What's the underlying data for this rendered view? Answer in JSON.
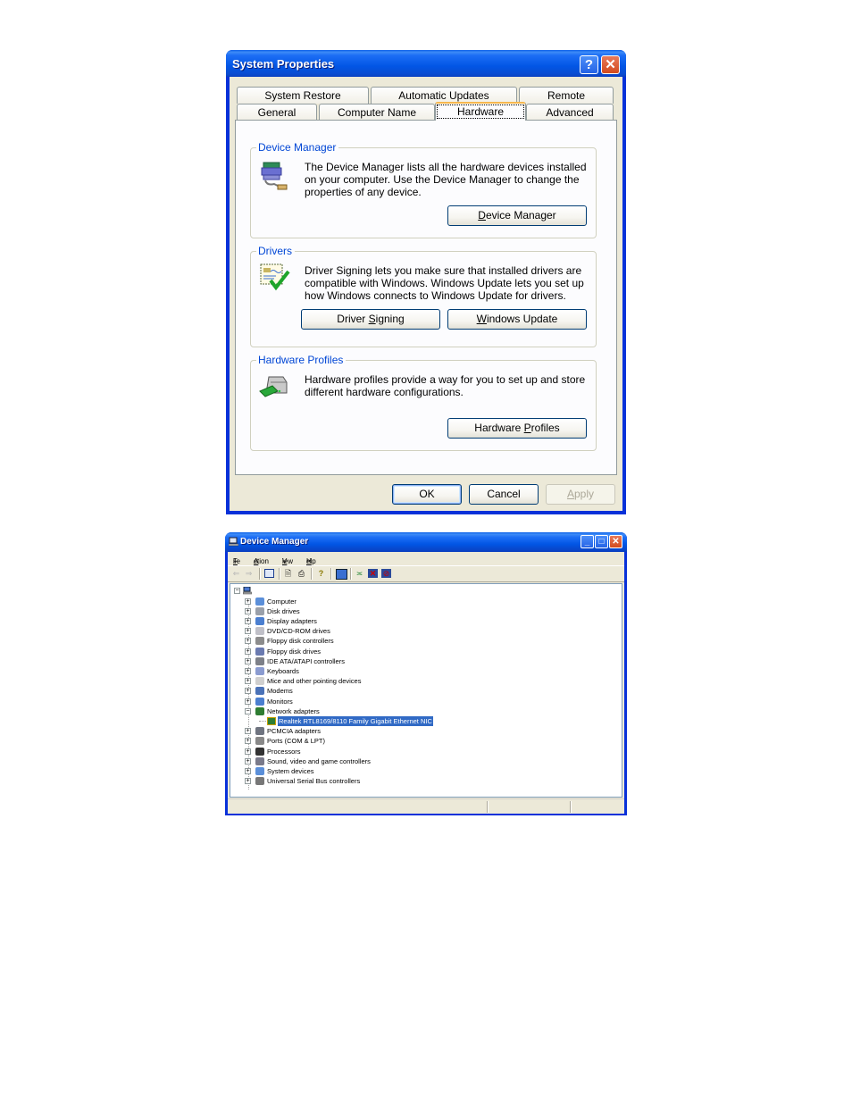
{
  "system_properties": {
    "title": "System Properties",
    "help_icon_label": "?",
    "close_icon_label": "✕",
    "tabs_row1": [
      {
        "label": "System Restore"
      },
      {
        "label": "Automatic Updates"
      },
      {
        "label": "Remote"
      }
    ],
    "tabs_row2": [
      {
        "label": "General"
      },
      {
        "label": "Computer Name"
      },
      {
        "label": "Hardware",
        "active": true
      },
      {
        "label": "Advanced"
      }
    ],
    "groups": {
      "device_manager": {
        "legend": "Device Manager",
        "text": "The Device Manager lists all the hardware devices installed on your computer. Use the Device Manager to change the properties of any device.",
        "button_prefix": "",
        "button_mnemonic": "D",
        "button_suffix": "evice Manager"
      },
      "drivers": {
        "legend": "Drivers",
        "text": "Driver Signing lets you make sure that installed drivers are compatible with Windows. Windows Update lets you set up how Windows connects to Windows Update for drivers.",
        "signing_prefix": "Driver ",
        "signing_mnemonic": "S",
        "signing_suffix": "igning",
        "update_prefix": "",
        "update_mnemonic": "W",
        "update_suffix": "indows Update"
      },
      "hardware_profiles": {
        "legend": "Hardware Profiles",
        "text": "Hardware profiles provide a way for you to set up and store different hardware configurations.",
        "button_prefix": "Hardware ",
        "button_mnemonic": "P",
        "button_suffix": "rofiles"
      }
    },
    "footer": {
      "ok_label": "OK",
      "cancel_label": "Cancel",
      "apply_mnemonic": "A",
      "apply_suffix": "pply",
      "apply_enabled": false
    }
  },
  "device_manager": {
    "title": "Device Manager",
    "window_controls": {
      "minimize": "_",
      "maximize": "□",
      "close": "✕"
    },
    "menu": [
      {
        "mnemonic": "F",
        "rest": "ile"
      },
      {
        "mnemonic": "A",
        "rest": "ction"
      },
      {
        "mnemonic": "V",
        "rest": "iew"
      },
      {
        "mnemonic": "H",
        "rest": "elp"
      }
    ],
    "toolbar": [
      "back",
      "forward",
      "show-hide-console-tree",
      "properties",
      "print",
      "help",
      "scan-hardware",
      "update-driver",
      "uninstall",
      "disable"
    ],
    "tree": {
      "root_expanded": true,
      "categories": [
        {
          "label": "Computer",
          "icon": "computer-icon",
          "expanded": false
        },
        {
          "label": "Disk drives",
          "icon": "disk-drive-icon",
          "expanded": false
        },
        {
          "label": "Display adapters",
          "icon": "display-adapter-icon",
          "expanded": false
        },
        {
          "label": "DVD/CD-ROM drives",
          "icon": "cdrom-icon",
          "expanded": false
        },
        {
          "label": "Floppy disk controllers",
          "icon": "floppy-controller-icon",
          "expanded": false
        },
        {
          "label": "Floppy disk drives",
          "icon": "floppy-drive-icon",
          "expanded": false
        },
        {
          "label": "IDE ATA/ATAPI controllers",
          "icon": "ide-controller-icon",
          "expanded": false
        },
        {
          "label": "Keyboards",
          "icon": "keyboard-icon",
          "expanded": false
        },
        {
          "label": "Mice and other pointing devices",
          "icon": "mouse-icon",
          "expanded": false
        },
        {
          "label": "Modems",
          "icon": "modem-icon",
          "expanded": false
        },
        {
          "label": "Monitors",
          "icon": "monitor-icon",
          "expanded": false
        },
        {
          "label": "Network adapters",
          "icon": "network-adapter-icon",
          "expanded": true,
          "children": [
            {
              "label": "Realtek RTL8169/8110 Family Gigabit Ethernet NIC",
              "selected": true
            }
          ]
        },
        {
          "label": "PCMCIA adapters",
          "icon": "pcmcia-icon",
          "expanded": false
        },
        {
          "label": "Ports (COM & LPT)",
          "icon": "port-icon",
          "expanded": false
        },
        {
          "label": "Processors",
          "icon": "processor-icon",
          "expanded": false
        },
        {
          "label": "Sound, video and game controllers",
          "icon": "sound-icon",
          "expanded": false
        },
        {
          "label": "System devices",
          "icon": "system-device-icon",
          "expanded": false
        },
        {
          "label": "Universal Serial Bus controllers",
          "icon": "usb-icon",
          "expanded": false
        }
      ]
    }
  },
  "colors": {
    "titlebar_blue": "#0256e5",
    "window_border": "#0831d9",
    "dialog_bg": "#ece9d8",
    "group_legend": "#0046d5",
    "selection": "#316ac5",
    "active_tab_accent": "#f7b74e"
  }
}
